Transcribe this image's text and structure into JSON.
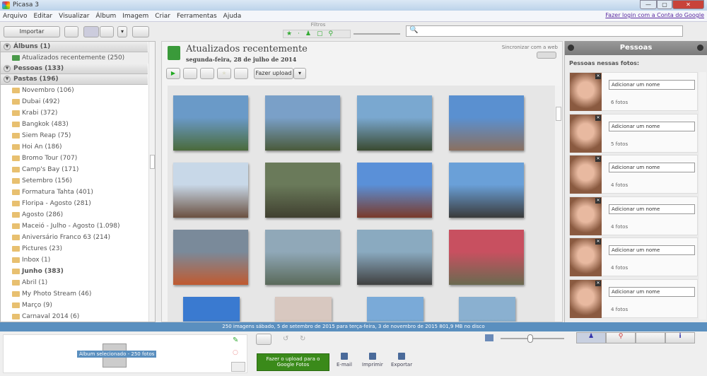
{
  "window": {
    "title": "Picasa 3",
    "minimize": "—",
    "maximize": "▢",
    "close": "✕"
  },
  "menu": [
    "Arquivo",
    "Editar",
    "Visualizar",
    "Álbum",
    "Imagem",
    "Criar",
    "Ferramentas",
    "Ajuda"
  ],
  "login_link": "Fazer login com a Conta do Google",
  "toolbar": {
    "import": "Importar",
    "filters_label": "Filtros"
  },
  "search": {
    "value": "",
    "placeholder": ""
  },
  "left": {
    "albums": "Álbuns (1)",
    "album_items": [
      "Atualizados recentemente (250)"
    ],
    "people": "Pessoas (133)",
    "folders": "Pastas (196)",
    "folder_items": [
      "Novembro (106)",
      "Dubai (492)",
      "Krabi (372)",
      "Bangkok (483)",
      "Siem Reap (75)",
      "Hoi An (186)",
      "Bromo Tour (707)",
      "Camp's Bay (171)",
      "Setembro (156)",
      "Formatura Tahta (401)",
      "Floripa - Agosto (281)",
      "Agosto (286)",
      "Maceió - Julho - Agosto (1.098)",
      "Aniversário Franco 63 (214)",
      "Pictures (23)",
      "Inbox (1)",
      "Junho (383)",
      "Abril (1)",
      "My Photo Stream (46)",
      "Março (9)",
      "Carnaval 2014 (6)"
    ],
    "bold_folder": "Junho (383)"
  },
  "main": {
    "title": "Atualizados recentemente",
    "date": "segunda-feira, 28 de julho de 2014",
    "sync": "Sincronizar com a web",
    "upload": "Fazer upload"
  },
  "photos": [
    [
      "#6a9ac8",
      "#4a6a3a"
    ],
    [
      "#7aa0c8",
      "#4a5a3a"
    ],
    [
      "#7aa8d0",
      "#3a4a30"
    ],
    [
      "#5a90d0",
      "#8a7060"
    ],
    [
      "#c8d8e8",
      "#6a5040"
    ],
    [
      "#6a7a5a",
      "#404030"
    ],
    [
      "#5a90d8",
      "#7a3a2a"
    ],
    [
      "#6aa0d8",
      "#3a3a3a"
    ],
    [
      "#7a8a9a",
      "#c05a30"
    ],
    [
      "#90a8b8",
      "#5a6a5a"
    ],
    [
      "#8aaac0",
      "#404040"
    ],
    [
      "#c85060",
      "#6a6a50"
    ],
    [
      "#3a7ad0",
      "#5a8a4a"
    ],
    [
      "#d8c8c0",
      "#a0705a"
    ],
    [
      "#7aaad8",
      "#3a6a3a"
    ],
    [
      "#8ab0d0",
      "#4a6a4a"
    ]
  ],
  "people": {
    "title": "Pessoas",
    "subtitle": "Pessoas nessas fotos:",
    "placeholder": "Adicionar um nome",
    "items": [
      {
        "count": "6 fotos"
      },
      {
        "count": "5 fotos"
      },
      {
        "count": "4 fotos"
      },
      {
        "count": "4 fotos"
      },
      {
        "count": "4 fotos"
      },
      {
        "count": "4 fotos"
      }
    ]
  },
  "status": "250 imagens     sábado, 5 de setembro de 2015 para terça-feira, 3 de novembro de 2015     801,9 MB no disco",
  "bottom": {
    "tray_label": "Álbum selecionado - 250 fotos",
    "upload": "Fazer o upload para o Google Fotos",
    "email": "E-mail",
    "print": "Imprimir",
    "export": "Exportar"
  }
}
